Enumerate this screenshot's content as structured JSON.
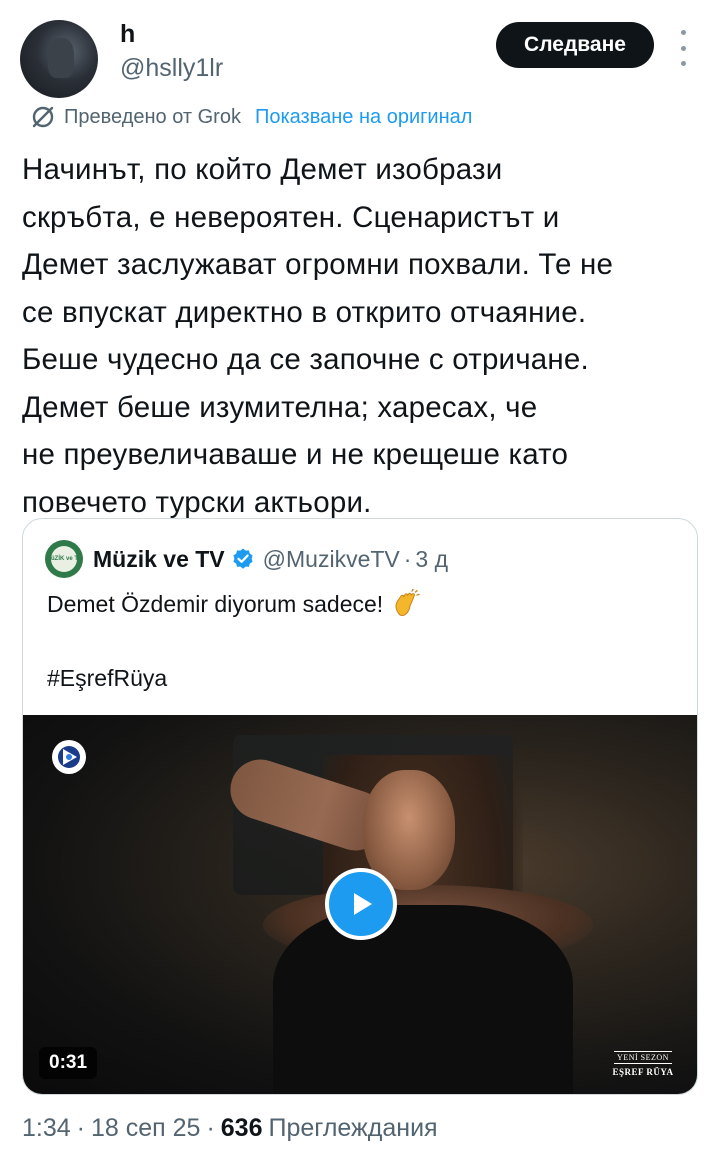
{
  "author": {
    "name": "h",
    "handle": "@hslly1lr",
    "follow_label": "Следване"
  },
  "translation": {
    "translated_by": "Преведено от Grok",
    "show_original": "Показване на оригинал",
    "icon": "translate-icon"
  },
  "tweet": {
    "text": " Начинът, по който Демет изобрази\nскръбта, е невероятен. Сценаристът и\nДемет заслужават огромни похвали. Те не\nсе впускат директно в открито отчаяние.\nБеше чудесно да се започне с отричане.\nДемет беше изумителна; харесах, че\nне преувеличаваше и не крещеше като\nповечето турски актьори."
  },
  "quote": {
    "name": "Müzik ve TV",
    "handle": "@MuzikveTV",
    "separator": "·",
    "time": "3 д",
    "line1": "Demet Özdemir diyorum sadece!",
    "line2": "#EşrefRüya",
    "avatar_text": "MüZİK ve TV",
    "video": {
      "duration": "0:31",
      "badge_top": "YENİ SEZON",
      "badge_bottom": "EŞREF RÜYA"
    }
  },
  "footer": {
    "time": "1:34",
    "sep1": "·",
    "date": "18 сеп 25",
    "sep2": "·",
    "views_count": "636",
    "views_label": "Преглеждания"
  },
  "colors": {
    "accent": "#1d9bf0",
    "text": "#0f1419",
    "muted": "#536471",
    "border": "#cfd9de"
  }
}
